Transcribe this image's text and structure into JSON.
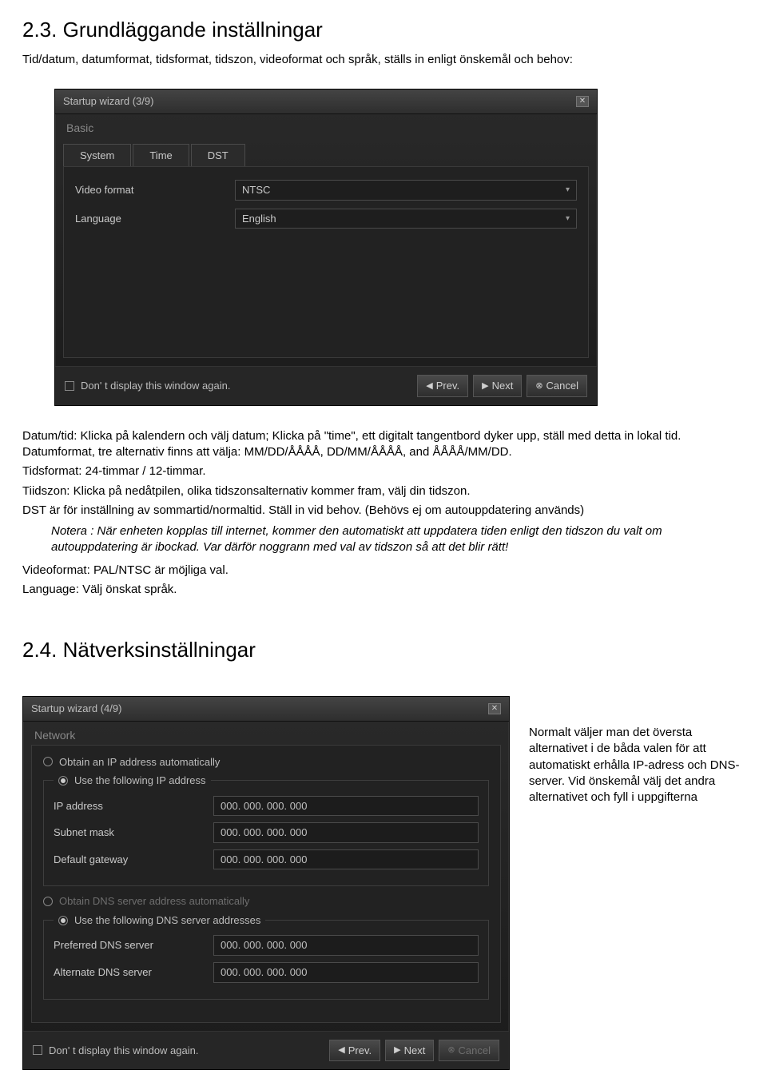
{
  "section23": {
    "title": "2.3. Grundläggande inställningar",
    "intro": "Tid/datum, datumformat, tidsformat, tidszon, videoformat och språk, ställs in enligt önskemål och behov:"
  },
  "wizard1": {
    "title": "Startup wizard (3/9)",
    "subtitle": "Basic",
    "tabs": [
      "System",
      "Time",
      "DST"
    ],
    "rows": [
      {
        "label": "Video format",
        "value": "NTSC"
      },
      {
        "label": "Language",
        "value": "English"
      }
    ],
    "footer_check": "Don' t display this window again.",
    "buttons": {
      "prev": "Prev.",
      "next": "Next",
      "cancel": "Cancel"
    }
  },
  "body": {
    "p1": "Datum/tid: Klicka på kalendern och välj datum; Klicka på \"time\", ett digitalt tangentbord dyker upp, ställ med detta in lokal tid. Datumformat, tre alternativ finns att välja: MM/DD/ÅÅÅÅ, DD/MM/ÅÅÅÅ, and ÅÅÅÅ/MM/DD.",
    "p2": "Tidsformat: 24-timmar / 12-timmar.",
    "p3": "Tiidszon: Klicka på nedåtpilen, olika tidszonsalternativ kommer fram, välj din tidszon.",
    "p4": "DST är för inställning av sommartid/normaltid. Ställ in vid behov. (Behövs ej om autouppdatering används)",
    "note_label": "Notera : ",
    "note": "När enheten kopplas till internet, kommer den automatiskt att uppdatera tiden enligt den tidszon du valt om autouppdatering är ibockad. Var därför noggrann med val av tidszon så att det blir rätt!",
    "p5": "Videoformat: PAL/NTSC är möjliga val.",
    "p6": "Language: Välj önskat språk."
  },
  "section24": {
    "title": "2.4. Nätverksinställningar",
    "side_text": "Normalt väljer man det översta alternativet i de båda valen för att automatiskt erhålla IP-adress och DNS-server. Vid önskemål välj det andra alternativet och fyll i uppgifterna"
  },
  "wizard2": {
    "title": "Startup wizard (4/9)",
    "subtitle": "Network",
    "radio_ip_auto": "Obtain an IP address automatically",
    "radio_ip_manual": "Use the following IP address",
    "ip_rows": [
      {
        "label": "IP address",
        "value": "000. 000. 000. 000"
      },
      {
        "label": "Subnet mask",
        "value": "000. 000. 000. 000"
      },
      {
        "label": "Default gateway",
        "value": "000. 000. 000. 000"
      }
    ],
    "radio_dns_auto": "Obtain DNS server address automatically",
    "radio_dns_manual": "Use the following DNS server addresses",
    "dns_rows": [
      {
        "label": "Preferred DNS server",
        "value": "000. 000. 000. 000"
      },
      {
        "label": "Alternate DNS server",
        "value": "000. 000. 000. 000"
      }
    ],
    "footer_check": "Don' t display this window again.",
    "buttons": {
      "prev": "Prev.",
      "next": "Next",
      "cancel": "Cancel"
    }
  }
}
